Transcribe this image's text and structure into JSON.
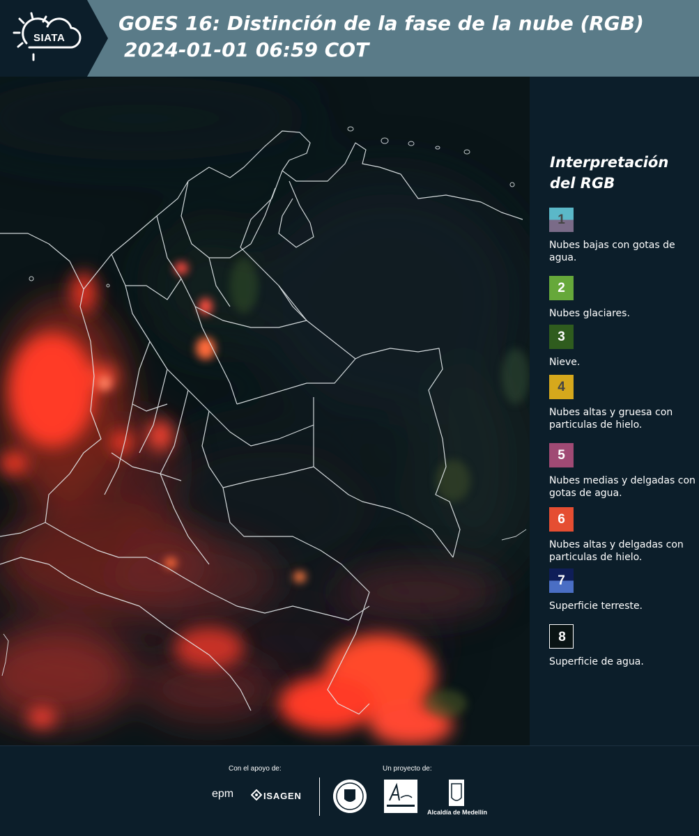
{
  "header": {
    "logo_text": "SIATA",
    "title_line1": "GOES 16: Distinción de la fase de la nube (RGB)",
    "title_line2": "2024-01-01 06:59 COT"
  },
  "legend": {
    "title_line1": "Interpretación",
    "title_line2": "del RGB",
    "items": [
      {
        "num": "1",
        "label": "Nubes bajas con gotas de agua.",
        "color_top": "#5bb8c8",
        "color_bottom": "#7a6b88",
        "num_color": "#444444"
      },
      {
        "num": "2",
        "label": "Nubes glaciares.",
        "color_top": "#66a83a",
        "color_bottom": "#66a83a",
        "num_color": "#ffffff"
      },
      {
        "num": "3",
        "label": "Nieve.",
        "color_top": "#2f5c1e",
        "color_bottom": "#2f5c1e",
        "num_color": "#ffffff"
      },
      {
        "num": "4",
        "label": "Nubes altas y gruesa con particulas de hielo.",
        "color_top": "#d6a81c",
        "color_bottom": "#d6a81c",
        "num_color": "#444444"
      },
      {
        "num": "5",
        "label": "Nubes medias y delgadas con gotas de agua.",
        "color_top": "#a04a74",
        "color_bottom": "#a04a74",
        "num_color": "#ffffff"
      },
      {
        "num": "6",
        "label": "Nubes altas y delgadas con particulas de hielo.",
        "color_top": "#e54e32",
        "color_bottom": "#e54e32",
        "num_color": "#ffffff"
      },
      {
        "num": "7",
        "label": "Superficie terreste.",
        "color_top": "#0f1e58",
        "color_bottom": "#4a6ec4",
        "num_color": "#ffffff"
      },
      {
        "num": "8",
        "label": "Superficie de agua.",
        "color_top": "#0a1414",
        "color_bottom": "#0a1414",
        "num_color": "#ffffff"
      }
    ]
  },
  "footer": {
    "support_label": "Con el apoyo de:",
    "project_label": "Un proyecto de:",
    "epm": "epm",
    "isagen": "ISAGEN",
    "alcaldia": "Alcaldía de Medellín"
  },
  "colors": {
    "header_bg": "#5a7b88",
    "panel_bg": "#0c1e2a",
    "cloud_red": "#ff3a28"
  }
}
